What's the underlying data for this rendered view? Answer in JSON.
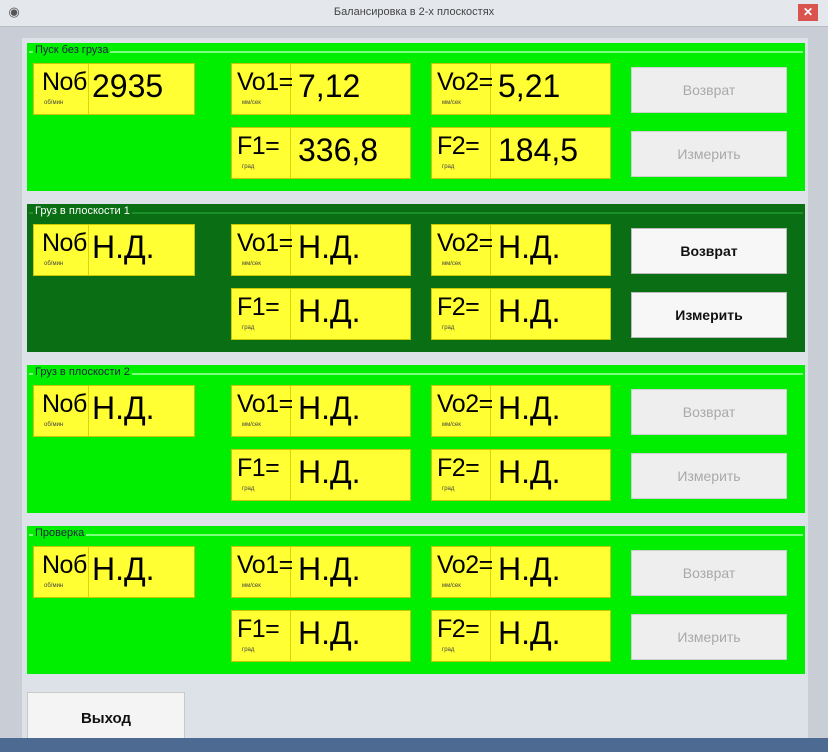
{
  "window": {
    "title": "Балансировка в 2-х плоскостях",
    "close_glyph": "✕",
    "app_glyph": "◉"
  },
  "labels": {
    "nob": "Nоб",
    "nob_unit": "об/мин",
    "vo1": "Vo1=",
    "vo2": "Vo2=",
    "v_unit": "мм/сек",
    "f1": "F1=",
    "f2": "F2=",
    "f_unit": "град",
    "back": "Возврат",
    "measure": "Измерить"
  },
  "sections": [
    {
      "title": "Пуск без груза",
      "nob": "2935",
      "vo1": "7,12",
      "vo2": "5,21",
      "f1": "336,8",
      "f2": "184,5",
      "enabled": false
    },
    {
      "title": "Груз в плоскости 1",
      "nob": "Н.Д.",
      "vo1": "Н.Д.",
      "vo2": "Н.Д.",
      "f1": "Н.Д.",
      "f2": "Н.Д.",
      "enabled": true
    },
    {
      "title": "Груз в плоскости 2",
      "nob": "Н.Д.",
      "vo1": "Н.Д.",
      "vo2": "Н.Д.",
      "f1": "Н.Д.",
      "f2": "Н.Д.",
      "enabled": false
    },
    {
      "title": "Проверка",
      "nob": "Н.Д.",
      "vo1": "Н.Д.",
      "vo2": "Н.Д.",
      "f1": "Н.Д.",
      "f2": "Н.Д.",
      "enabled": false
    }
  ],
  "exit_label": "Выход",
  "colors": {
    "panel_green": "#00ee00",
    "active_green": "#0a6e14",
    "value_yellow": "#ffff33"
  }
}
